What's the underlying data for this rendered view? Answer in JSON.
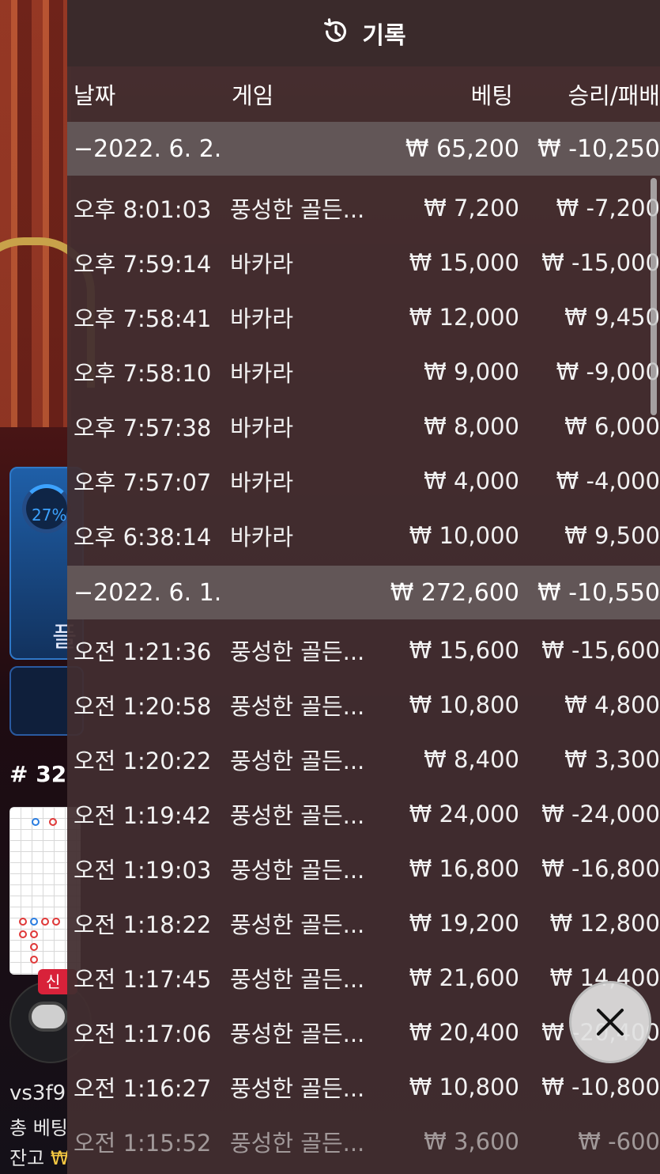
{
  "header": {
    "title": "기록",
    "icon": "history-icon"
  },
  "columns": {
    "date": "날짜",
    "game": "게임",
    "bet": "베팅",
    "result": "승리/패배"
  },
  "days": [
    {
      "date": "−2022. 6. 2.",
      "total_bet": "₩ 65,200",
      "total_result": "₩ -10,250",
      "rows": [
        {
          "time": "오후 8:01:03",
          "game": "풍성한 골든...",
          "bet": "₩ 7,200",
          "result": "₩ -7,200"
        },
        {
          "time": "오후 7:59:14",
          "game": "바카라",
          "bet": "₩ 15,000",
          "result": "₩ -15,000"
        },
        {
          "time": "오후 7:58:41",
          "game": "바카라",
          "bet": "₩ 12,000",
          "result": "₩ 9,450"
        },
        {
          "time": "오후 7:58:10",
          "game": "바카라",
          "bet": "₩ 9,000",
          "result": "₩ -9,000"
        },
        {
          "time": "오후 7:57:38",
          "game": "바카라",
          "bet": "₩ 8,000",
          "result": "₩ 6,000"
        },
        {
          "time": "오후 7:57:07",
          "game": "바카라",
          "bet": "₩ 4,000",
          "result": "₩ -4,000"
        },
        {
          "time": "오후 6:38:14",
          "game": "바카라",
          "bet": "₩ 10,000",
          "result": "₩ 9,500"
        }
      ]
    },
    {
      "date": "−2022. 6. 1.",
      "total_bet": "₩ 272,600",
      "total_result": "₩ -10,550",
      "rows": [
        {
          "time": "오전 1:21:36",
          "game": "풍성한 골든...",
          "bet": "₩ 15,600",
          "result": "₩ -15,600"
        },
        {
          "time": "오전 1:20:58",
          "game": "풍성한 골든...",
          "bet": "₩ 10,800",
          "result": "₩ 4,800"
        },
        {
          "time": "오전 1:20:22",
          "game": "풍성한 골든...",
          "bet": "₩ 8,400",
          "result": "₩ 3,300"
        },
        {
          "time": "오전 1:19:42",
          "game": "풍성한 골든...",
          "bet": "₩ 24,000",
          "result": "₩ -24,000"
        },
        {
          "time": "오전 1:19:03",
          "game": "풍성한 골든...",
          "bet": "₩ 16,800",
          "result": "₩ -16,800"
        },
        {
          "time": "오전 1:18:22",
          "game": "풍성한 골든...",
          "bet": "₩ 19,200",
          "result": "₩ 12,800"
        },
        {
          "time": "오전 1:17:45",
          "game": "풍성한 골든...",
          "bet": "₩ 21,600",
          "result": "₩ 14,400"
        },
        {
          "time": "오전 1:17:06",
          "game": "풍성한 골든...",
          "bet": "₩ 20,400",
          "result": "₩ -20,400"
        },
        {
          "time": "오전 1:16:27",
          "game": "풍성한 골든...",
          "bet": "₩ 10,800",
          "result": "₩ -10,800"
        },
        {
          "time": "오전 1:15:52",
          "game": "풍성한 골든...",
          "bet": "₩ 3,600",
          "result": "₩ -600"
        }
      ]
    }
  ],
  "background": {
    "progress_percent": "27%",
    "panel_label": "플",
    "round_number": "# 32",
    "new_badge": "신",
    "user_id": "vs3f9",
    "total_bet_label": "총 베팅",
    "balance_label": "잔고",
    "balance_currency": "₩"
  },
  "colors": {
    "overlay": "#422e30",
    "day_row": "#625657",
    "accent_blue": "#3ca2ff",
    "badge_red": "#d8223a"
  }
}
